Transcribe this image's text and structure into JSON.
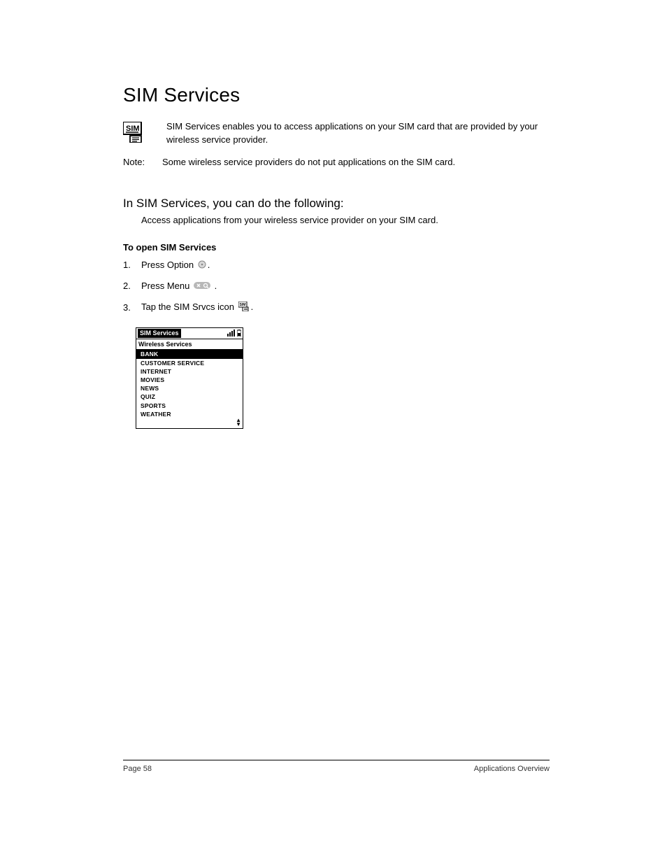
{
  "title": "SIM Services",
  "intro": "SIM Services enables you to access applications on your SIM card that are provided by your wireless service provider.",
  "note_label": "Note:",
  "note_text": "Some wireless service providers do not put applications on the SIM card.",
  "subheading": "In SIM Services, you can do the following:",
  "sub_desc": "Access applications from your wireless service provider on your SIM card.",
  "open_heading": "To open SIM Services",
  "steps": {
    "s1_num": "1.",
    "s1a": "Press Option ",
    "s1b": ".",
    "s2_num": "2.",
    "s2a": "Press Menu ",
    "s2b": " .",
    "s3_num": "3.",
    "s3a": "Tap the SIM Srvcs icon ",
    "s3b": "."
  },
  "screenshot": {
    "title": "SIM Services",
    "subheader": "Wireless Services",
    "items": {
      "i0": "BANK",
      "i1": "CUSTOMER SERVICE",
      "i2": "INTERNET",
      "i3": "MOVIES",
      "i4": "NEWS",
      "i5": "QUIZ",
      "i6": "SPORTS",
      "i7": "WEATHER"
    }
  },
  "footer": {
    "left": "Page 58",
    "right": "Applications Overview"
  }
}
